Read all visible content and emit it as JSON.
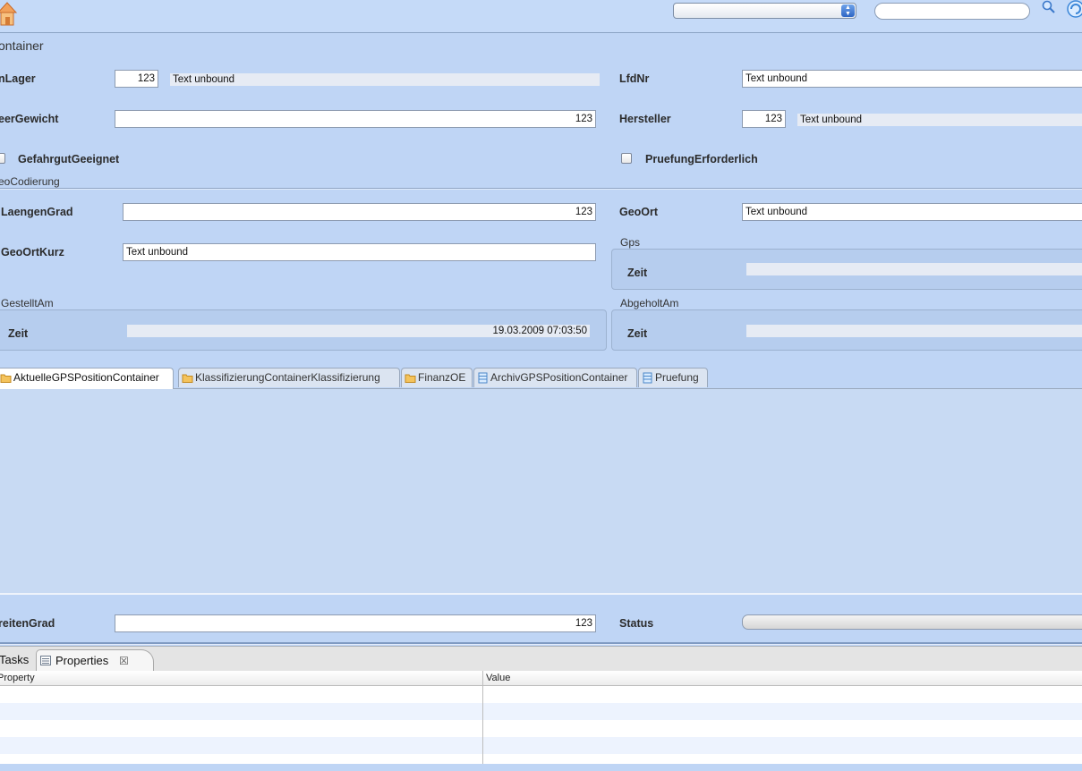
{
  "toolbar": {
    "view_select_value": "",
    "search_value": ""
  },
  "section_title": "ontainer",
  "fields": {
    "lager_label": "nLager",
    "lager_value": "123",
    "lager_text": "Text unbound",
    "lfdnr_label": "LfdNr",
    "lfdnr_value": "Text unbound",
    "leergewicht_label": "eerGewicht",
    "leergewicht_value": "123",
    "hersteller_label": "Hersteller",
    "hersteller_value": "123",
    "hersteller_text": "Text unbound",
    "gefahrgut_label": "GefahrgutGeeignet",
    "gefahrgut_checked": false,
    "pruefung_label": "PruefungErforderlich",
    "pruefung_checked": false
  },
  "geocodierung": {
    "group_label": "eoCodierung",
    "laengengrad_label": "LaengenGrad",
    "laengengrad_value": "123",
    "geoort_label": "GeoOrt",
    "geoort_value": "Text unbound",
    "geoortkurz_label": "GeoOrtKurz",
    "geoortkurz_value": "Text unbound",
    "gps_label": "Gps",
    "gps_zeit_label": "Zeit",
    "gps_zeit_value": ""
  },
  "gestellt_am": {
    "group_label": "GestelltAm",
    "zeit_label": "Zeit",
    "zeit_value": "19.03.2009 07:03:50"
  },
  "abgeholt_am": {
    "group_label": "AbgeholtAm",
    "zeit_label": "Zeit",
    "zeit_value": ""
  },
  "tabs": [
    {
      "label": "AktuelleGPSPositionContainer",
      "icon": "folder-icon",
      "active": true
    },
    {
      "label": "KlassifizierungContainerKlassifizierung",
      "icon": "folder-icon",
      "active": false
    },
    {
      "label": "FinanzOE",
      "icon": "folder-icon",
      "active": false
    },
    {
      "label": "ArchivGPSPositionContainer",
      "icon": "table-icon",
      "active": false
    },
    {
      "label": "Pruefung",
      "icon": "table-icon",
      "active": false
    }
  ],
  "bottom_fields": {
    "breitengrad_label": "reitenGrad",
    "breitengrad_value": "123",
    "status_label": "Status"
  },
  "views": {
    "tasks_label": "Tasks",
    "properties_label": "Properties",
    "close_glyph": "☒"
  },
  "properties_table": {
    "columns": [
      "Property",
      "Value"
    ]
  },
  "colors": {
    "background": "#bfd5f5",
    "tab_content": "#c8daf3",
    "alt_row": "#edf3fe"
  }
}
